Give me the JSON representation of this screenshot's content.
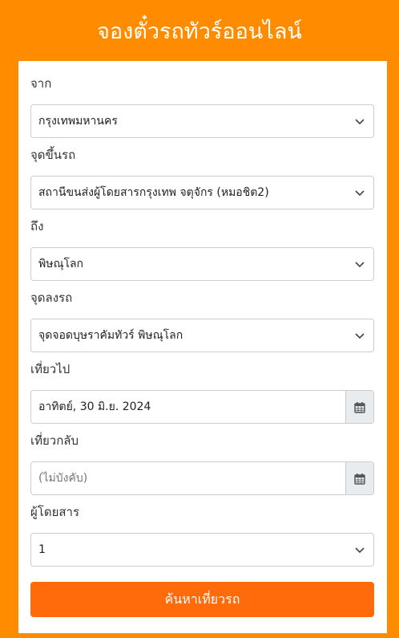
{
  "header": {
    "title": "จองตั๋วรถทัวร์ออนไลน์"
  },
  "form": {
    "from": {
      "label": "จาก",
      "value": "กรุงเทพมหานคร"
    },
    "pickup": {
      "label": "จุดขึ้นรถ",
      "value": "สถานีขนส่งผู้โดยสารกรุงเทพ จตุจักร (หมอชิต2)"
    },
    "to": {
      "label": "ถึง",
      "value": "พิษณุโลก"
    },
    "dropoff": {
      "label": "จุดลงรถ",
      "value": "จุดจอดบุษราคัมทัวร์ พิษณุโลก"
    },
    "depart": {
      "label": "เที่ยวไป",
      "value": "อาทิตย์, 30 มิ.ย. 2024"
    },
    "return": {
      "label": "เที่ยวกลับ",
      "placeholder": "(ไม่บังคับ)"
    },
    "passengers": {
      "label": "ผู้โดยสาร",
      "value": "1"
    },
    "search_label": "ค้นหาเที่ยวรถ"
  },
  "colors": {
    "brand": "#FF8C00",
    "button": "#FF6A0A"
  }
}
